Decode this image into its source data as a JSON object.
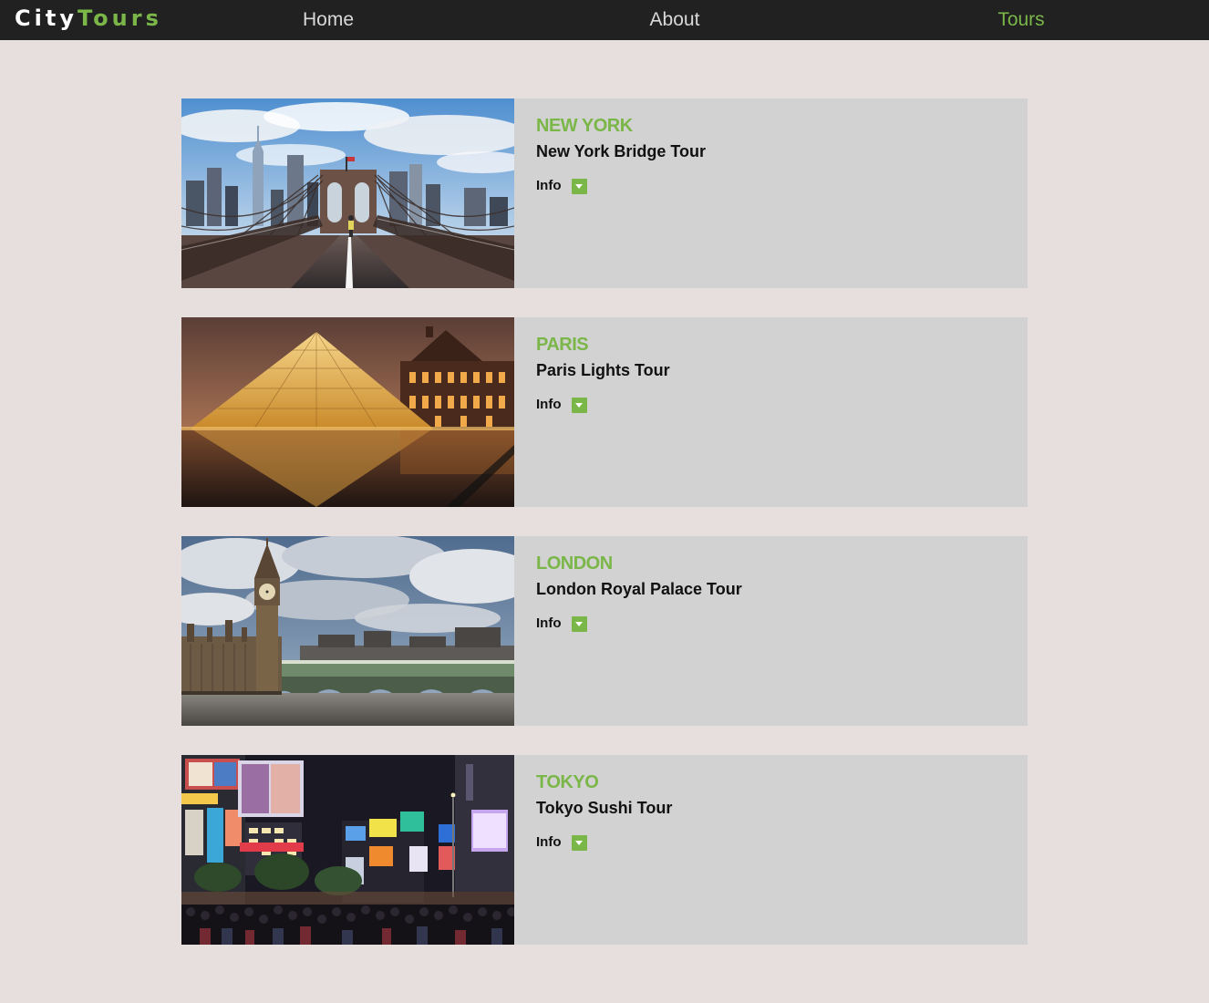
{
  "brand": {
    "part1": "City",
    "part2": "Tours",
    "accent_color": "#7ab648"
  },
  "nav": {
    "items": [
      {
        "label": "Home",
        "active": false
      },
      {
        "label": "About",
        "active": false
      },
      {
        "label": "Tours",
        "active": true
      }
    ]
  },
  "tours": [
    {
      "city": "NEW YORK",
      "name": "New York Bridge Tour",
      "info_label": "Info",
      "photo": "brooklyn-bridge-photo",
      "toggle_icon": "caret-down-icon"
    },
    {
      "city": "PARIS",
      "name": "Paris Lights Tour",
      "info_label": "Info",
      "photo": "louvre-pyramid-photo",
      "toggle_icon": "caret-down-icon"
    },
    {
      "city": "LONDON",
      "name": "London Royal Palace Tour",
      "info_label": "Info",
      "photo": "big-ben-westminster-photo",
      "toggle_icon": "caret-down-icon"
    },
    {
      "city": "TOKYO",
      "name": "Tokyo Sushi Tour",
      "info_label": "Info",
      "photo": "shibuya-crossing-photo",
      "toggle_icon": "caret-down-icon"
    }
  ],
  "colors": {
    "navbar_bg": "#212121",
    "page_bg": "#e6dfdd",
    "card_bg": "#d2d2d2",
    "accent": "#7ab648"
  }
}
